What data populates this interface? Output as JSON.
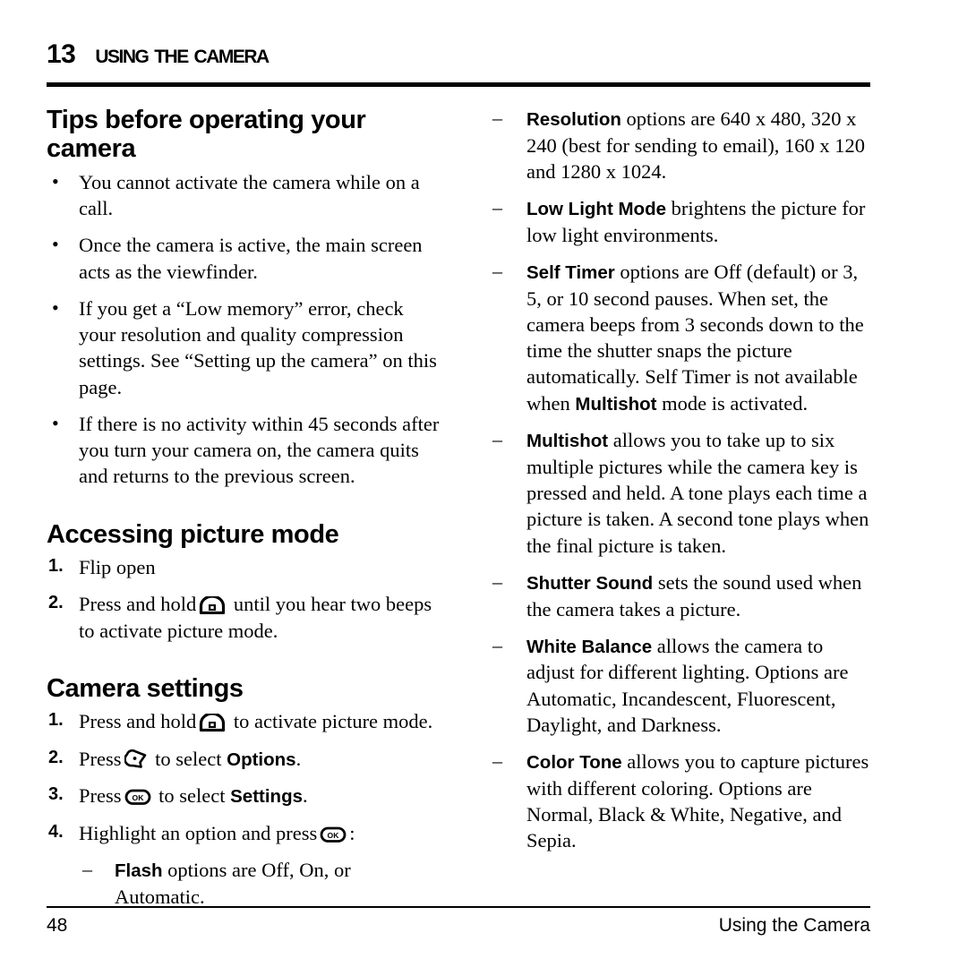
{
  "header": {
    "chapter_number": "13",
    "chapter_title": "Using the Camera"
  },
  "left_column": {
    "tips_heading": "Tips before operating your camera",
    "tips_bullets": [
      "You cannot activate the camera while on a call.",
      "Once the camera is active, the main screen acts as the viewfinder.",
      "If you get a “Low memory” error, check your resolution and quality compression settings. See “Setting up the camera” on this page.",
      "If there is no activity within 45 seconds after you turn your camera on, the camera quits and returns to the previous screen."
    ],
    "accessing_heading": "Accessing picture mode",
    "accessing_steps": [
      {
        "num": "1.",
        "text_before": "Flip open",
        "icon": "",
        "text_after": ""
      },
      {
        "num": "2.",
        "text_before": "Press and hold",
        "icon": "camera-key-icon",
        "text_after": "until you hear two beeps to activate picture mode."
      }
    ],
    "settings_heading": "Camera settings",
    "settings_steps": [
      {
        "num": "1.",
        "text_before": "Press and hold",
        "icon": "camera-key-icon",
        "text_after": "to activate picture mode."
      },
      {
        "num": "2.",
        "text_before": "Press",
        "icon": "left-softkey-icon",
        "text_after": "to select ",
        "ui_label": "Options",
        "text_end": "."
      },
      {
        "num": "3.",
        "text_before": "Press",
        "icon": "ok-key-icon",
        "text_after": "to select ",
        "ui_label": "Settings",
        "text_end": "."
      },
      {
        "num": "4.",
        "text_before": "Highlight an option and press",
        "icon": "ok-key-icon",
        "text_after": ":"
      }
    ],
    "flash_sub_item": {
      "term": "Flash",
      "text": " options are Off, On, or Automatic."
    }
  },
  "right_column": {
    "items": [
      {
        "term": "Resolution",
        "text": " options are 640 x 480, 320 x 240 (best for sending to email), 160 x 120 and 1280 x 1024."
      },
      {
        "term": "Low Light Mode",
        "text": " brightens the picture for low light environments."
      },
      {
        "term": "Self Timer",
        "text_1": " options are Off (default) or 3, 5, or 10 second pauses. When set, the camera beeps from 3 seconds down to the time the shutter snaps the picture automatically. Self Timer is not available when ",
        "term_2": "Multishot",
        "text_2": " mode is activated."
      },
      {
        "term": "Multishot",
        "text": " allows you to take up to six multiple pictures while the camera key is pressed and held. A tone plays each time a picture is taken. A second tone plays when the final picture is taken."
      },
      {
        "term": "Shutter Sound",
        "text": " sets the sound used when the camera takes a picture."
      },
      {
        "term": "White Balance",
        "text": " allows the camera to adjust for different lighting. Options are Automatic, Incandescent, Fluorescent, Daylight, and Darkness."
      },
      {
        "term": "Color Tone",
        "text": " allows you to capture pictures with different coloring. Options are Normal, Black & White, Negative, and Sepia."
      }
    ]
  },
  "footer": {
    "page_number": "48",
    "running_title": "Using the Camera"
  },
  "icons": {
    "camera_key": "camera-key-icon",
    "left_softkey": "left-softkey-icon",
    "ok_key": "ok-key-icon",
    "ok_key_label": "OK"
  }
}
